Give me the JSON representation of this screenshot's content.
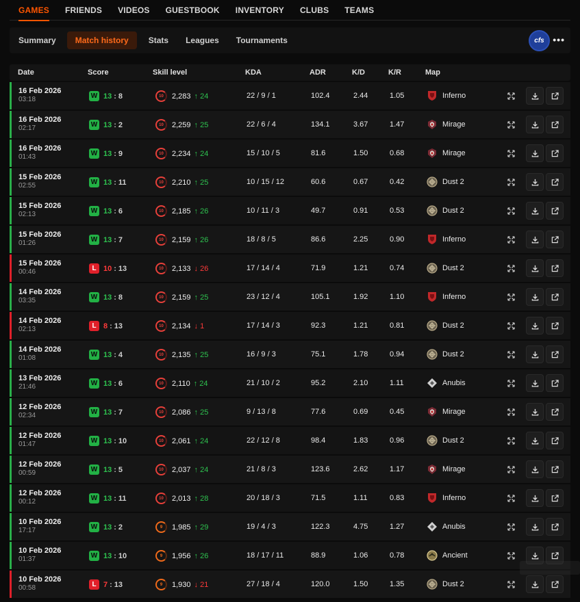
{
  "topnav": {
    "items": [
      "GAMES",
      "FRIENDS",
      "VIDEOS",
      "GUESTBOOK",
      "INVENTORY",
      "CLUBS",
      "TEAMS"
    ],
    "active": 0
  },
  "subnav": {
    "tabs": [
      "Summary",
      "Match history",
      "Stats",
      "Leagues",
      "Tournaments"
    ],
    "active": 1,
    "logo_text": "cfs",
    "more_label": "•••"
  },
  "table": {
    "headers": {
      "date": "Date",
      "score": "Score",
      "skill": "Skill level",
      "kda": "KDA",
      "adr": "ADR",
      "kd": "K/D",
      "kr": "K/R",
      "map": "Map"
    },
    "rows": [
      {
        "date": "16 Feb 2026",
        "time": "03:18",
        "result": "W",
        "score_a": "13",
        "score_b": "8",
        "level": "10",
        "elo": "2,283",
        "delta": "↑ 24",
        "kda": "22 / 9 / 1",
        "adr": "102.4",
        "kd": "2.44",
        "kr": "1.05",
        "map": "Inferno",
        "map_icon": "inferno-icon"
      },
      {
        "date": "16 Feb 2026",
        "time": "02:17",
        "result": "W",
        "score_a": "13",
        "score_b": "2",
        "level": "10",
        "elo": "2,259",
        "delta": "↑ 25",
        "kda": "22 / 6 / 4",
        "adr": "134.1",
        "kd": "3.67",
        "kr": "1.47",
        "map": "Mirage",
        "map_icon": "mirage-icon"
      },
      {
        "date": "16 Feb 2026",
        "time": "01:43",
        "result": "W",
        "score_a": "13",
        "score_b": "9",
        "level": "10",
        "elo": "2,234",
        "delta": "↑ 24",
        "kda": "15 / 10 / 5",
        "adr": "81.6",
        "kd": "1.50",
        "kr": "0.68",
        "map": "Mirage",
        "map_icon": "mirage-icon"
      },
      {
        "date": "15 Feb 2026",
        "time": "02:55",
        "result": "W",
        "score_a": "13",
        "score_b": "11",
        "level": "10",
        "elo": "2,210",
        "delta": "↑ 25",
        "kda": "10 / 15 / 12",
        "adr": "60.6",
        "kd": "0.67",
        "kr": "0.42",
        "map": "Dust 2",
        "map_icon": "dust2-icon"
      },
      {
        "date": "15 Feb 2026",
        "time": "02:13",
        "result": "W",
        "score_a": "13",
        "score_b": "6",
        "level": "10",
        "elo": "2,185",
        "delta": "↑ 26",
        "kda": "10 / 11 / 3",
        "adr": "49.7",
        "kd": "0.91",
        "kr": "0.53",
        "map": "Dust 2",
        "map_icon": "dust2-icon"
      },
      {
        "date": "15 Feb 2026",
        "time": "01:26",
        "result": "W",
        "score_a": "13",
        "score_b": "7",
        "level": "10",
        "elo": "2,159",
        "delta": "↑ 26",
        "kda": "18 / 8 / 5",
        "adr": "86.6",
        "kd": "2.25",
        "kr": "0.90",
        "map": "Inferno",
        "map_icon": "inferno-icon"
      },
      {
        "date": "15 Feb 2026",
        "time": "00:46",
        "result": "L",
        "score_a": "10",
        "score_b": "13",
        "level": "10",
        "elo": "2,133",
        "delta": "↓ 26",
        "kda": "17 / 14 / 4",
        "adr": "71.9",
        "kd": "1.21",
        "kr": "0.74",
        "map": "Dust 2",
        "map_icon": "dust2-icon"
      },
      {
        "date": "14 Feb 2026",
        "time": "03:35",
        "result": "W",
        "score_a": "13",
        "score_b": "8",
        "level": "10",
        "elo": "2,159",
        "delta": "↑ 25",
        "kda": "23 / 12 / 4",
        "adr": "105.1",
        "kd": "1.92",
        "kr": "1.10",
        "map": "Inferno",
        "map_icon": "inferno-icon"
      },
      {
        "date": "14 Feb 2026",
        "time": "02:13",
        "result": "L",
        "score_a": "8",
        "score_b": "13",
        "level": "10",
        "elo": "2,134",
        "delta": "↓ 1",
        "kda": "17 / 14 / 3",
        "adr": "92.3",
        "kd": "1.21",
        "kr": "0.81",
        "map": "Dust 2",
        "map_icon": "dust2-icon"
      },
      {
        "date": "14 Feb 2026",
        "time": "01:08",
        "result": "W",
        "score_a": "13",
        "score_b": "4",
        "level": "10",
        "elo": "2,135",
        "delta": "↑ 25",
        "kda": "16 / 9 / 3",
        "adr": "75.1",
        "kd": "1.78",
        "kr": "0.94",
        "map": "Dust 2",
        "map_icon": "dust2-icon"
      },
      {
        "date": "13 Feb 2026",
        "time": "21:46",
        "result": "W",
        "score_a": "13",
        "score_b": "6",
        "level": "10",
        "elo": "2,110",
        "delta": "↑ 24",
        "kda": "21 / 10 / 2",
        "adr": "95.2",
        "kd": "2.10",
        "kr": "1.11",
        "map": "Anubis",
        "map_icon": "anubis-icon"
      },
      {
        "date": "12 Feb 2026",
        "time": "02:34",
        "result": "W",
        "score_a": "13",
        "score_b": "7",
        "level": "10",
        "elo": "2,086",
        "delta": "↑ 25",
        "kda": "9 / 13 / 8",
        "adr": "77.6",
        "kd": "0.69",
        "kr": "0.45",
        "map": "Mirage",
        "map_icon": "mirage-icon"
      },
      {
        "date": "12 Feb 2026",
        "time": "01:47",
        "result": "W",
        "score_a": "13",
        "score_b": "10",
        "level": "10",
        "elo": "2,061",
        "delta": "↑ 24",
        "kda": "22 / 12 / 8",
        "adr": "98.4",
        "kd": "1.83",
        "kr": "0.96",
        "map": "Dust 2",
        "map_icon": "dust2-icon"
      },
      {
        "date": "12 Feb 2026",
        "time": "00:59",
        "result": "W",
        "score_a": "13",
        "score_b": "5",
        "level": "10",
        "elo": "2,037",
        "delta": "↑ 24",
        "kda": "21 / 8 / 3",
        "adr": "123.6",
        "kd": "2.62",
        "kr": "1.17",
        "map": "Mirage",
        "map_icon": "mirage-icon"
      },
      {
        "date": "12 Feb 2026",
        "time": "00:12",
        "result": "W",
        "score_a": "13",
        "score_b": "11",
        "level": "10",
        "elo": "2,013",
        "delta": "↑ 28",
        "kda": "20 / 18 / 3",
        "adr": "71.5",
        "kd": "1.11",
        "kr": "0.83",
        "map": "Inferno",
        "map_icon": "inferno-icon"
      },
      {
        "date": "10 Feb 2026",
        "time": "17:17",
        "result": "W",
        "score_a": "13",
        "score_b": "2",
        "level": "9",
        "elo": "1,985",
        "delta": "↑ 29",
        "kda": "19 / 4 / 3",
        "adr": "122.3",
        "kd": "4.75",
        "kr": "1.27",
        "map": "Anubis",
        "map_icon": "anubis-icon"
      },
      {
        "date": "10 Feb 2026",
        "time": "01:37",
        "result": "W",
        "score_a": "13",
        "score_b": "10",
        "level": "9",
        "elo": "1,956",
        "delta": "↑ 26",
        "kda": "18 / 17 / 11",
        "adr": "88.9",
        "kd": "1.06",
        "kr": "0.78",
        "map": "Ancient",
        "map_icon": "ancient-icon"
      },
      {
        "date": "10 Feb 2026",
        "time": "00:58",
        "result": "L",
        "score_a": "7",
        "score_b": "13",
        "level": "9",
        "elo": "1,930",
        "delta": "↓ 21",
        "kda": "27 / 18 / 4",
        "adr": "120.0",
        "kd": "1.50",
        "kr": "1.35",
        "map": "Dust 2",
        "map_icon": "dust2-icon"
      }
    ]
  },
  "colors": {
    "accent": "#ff5500",
    "win": "#2ec24f",
    "loss": "#e0202a",
    "background": "#0b0b0b",
    "row": "#141414"
  },
  "icons": {
    "expand": "expand-icon",
    "download": "download-icon",
    "open": "external-link-icon"
  }
}
